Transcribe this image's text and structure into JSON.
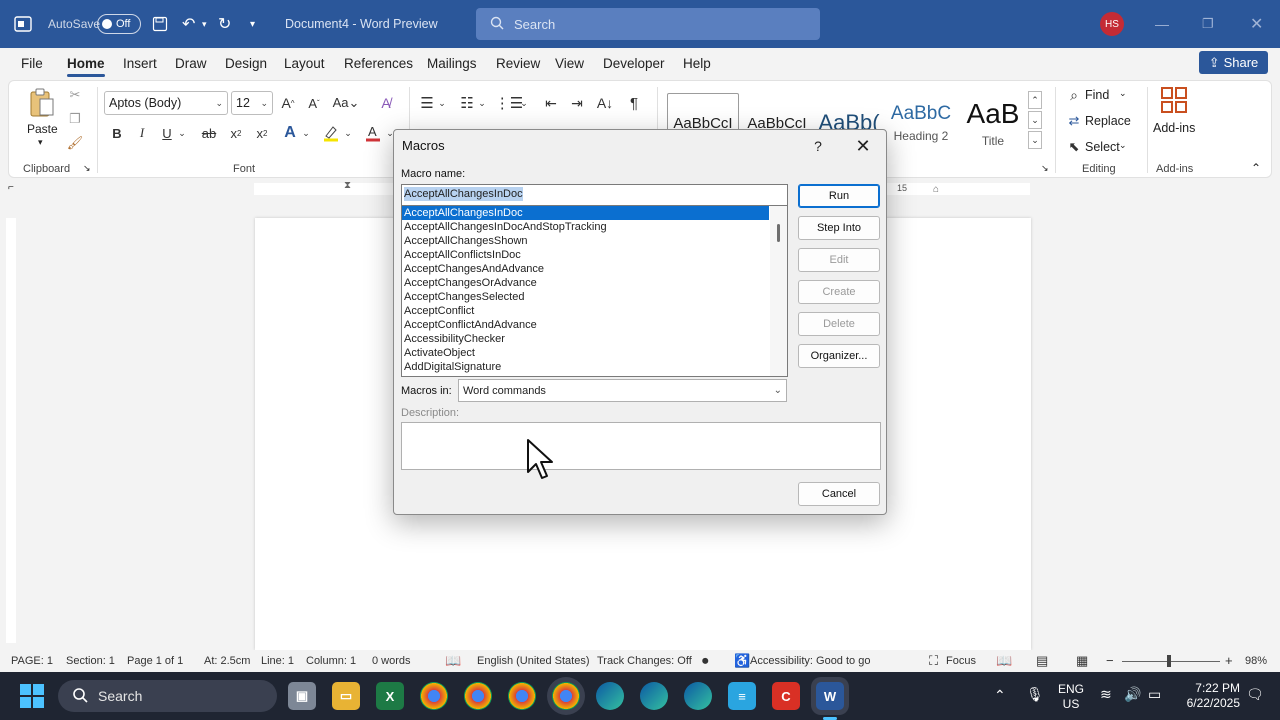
{
  "titlebar": {
    "autosave_label": "AutoSave",
    "autosave_state": "Off",
    "doc_title": "Document4 - Word Preview",
    "search_placeholder": "Search",
    "user_initials": "HS"
  },
  "menu": {
    "tabs": [
      "File",
      "Home",
      "Insert",
      "Draw",
      "Design",
      "Layout",
      "References",
      "Mailings",
      "Review",
      "View",
      "Developer",
      "Help"
    ],
    "active": "Home",
    "share_label": "Share"
  },
  "ribbon": {
    "clipboard": {
      "paste_label": "Paste",
      "group_label": "Clipboard"
    },
    "font": {
      "font_name": "Aptos (Body)",
      "font_size": "12",
      "group_label": "Font"
    },
    "styles": [
      {
        "preview": "AaBbCcI",
        "name": ""
      },
      {
        "preview": "AaBbCcI",
        "name": ""
      },
      {
        "preview": "AaBb(",
        "name": ""
      },
      {
        "preview": "AaBbC",
        "name": "Heading 2"
      },
      {
        "preview": "AaB",
        "name": "Title"
      }
    ],
    "editing": {
      "find": "Find",
      "replace": "Replace",
      "select": "Select",
      "group_label": "Editing"
    },
    "addins": {
      "label": "Add-ins",
      "group_label": "Add-ins"
    }
  },
  "ruler": {
    "mark": "15"
  },
  "dialog": {
    "title": "Macros",
    "help": "?",
    "macro_name_label": "Macro name:",
    "macro_name_value": "AcceptAllChangesInDoc",
    "macros": [
      "AcceptAllChangesInDoc",
      "AcceptAllChangesInDocAndStopTracking",
      "AcceptAllChangesShown",
      "AcceptAllConflictsInDoc",
      "AcceptChangesAndAdvance",
      "AcceptChangesOrAdvance",
      "AcceptChangesSelected",
      "AcceptConflict",
      "AcceptConflictAndAdvance",
      "AccessibilityChecker",
      "ActivateObject",
      "AddDigitalSignature"
    ],
    "selected_index": 0,
    "macros_in_label": "Macros in:",
    "macros_in_value": "Word commands",
    "description_label": "Description:",
    "buttons": {
      "run": "Run",
      "step_into": "Step Into",
      "edit": "Edit",
      "create": "Create",
      "delete": "Delete",
      "organizer": "Organizer...",
      "cancel": "Cancel"
    }
  },
  "statusbar": {
    "page": "PAGE: 1",
    "section": "Section: 1",
    "page_of": "Page 1 of 1",
    "at": "At: 2.5cm",
    "line": "Line: 1",
    "column": "Column: 1",
    "words": "0 words",
    "language": "English (United States)",
    "track_changes": "Track Changes: Off",
    "accessibility": "Accessibility: Good to go",
    "focus": "Focus",
    "zoom": "98%"
  },
  "taskbar": {
    "search_label": "Search",
    "lang_line1": "ENG",
    "lang_line2": "US",
    "time": "7:22 PM",
    "date": "6/22/2025"
  },
  "colors": {
    "word_blue": "#2b579a",
    "list_selection": "#0b6fd0",
    "taskbar": "#1f2532"
  }
}
